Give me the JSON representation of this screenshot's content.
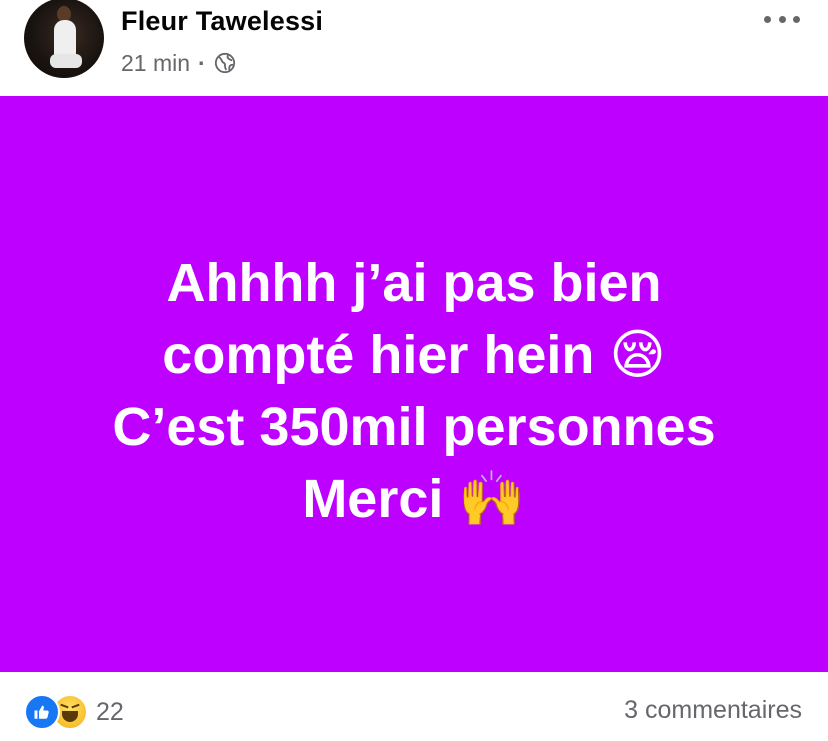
{
  "author": {
    "name": "Fleur Tawelessi",
    "avatar_icon": "profile-photo"
  },
  "meta": {
    "time": "21 min",
    "separator": "·",
    "audience_icon": "globe-icon"
  },
  "post": {
    "background_color": "#bd00ff",
    "text_color": "#ffffff",
    "lines": [
      "Ahhhh j’ai pas bien",
      "compté hier hein 😪",
      "C’est 350mil personnes",
      "Merci 🙌"
    ]
  },
  "footer": {
    "reaction_icons": [
      "like-icon",
      "haha-icon"
    ],
    "reaction_count": "22",
    "comments_label": "3 commentaires"
  },
  "menu": {
    "more_icon": "more-options-icon"
  }
}
